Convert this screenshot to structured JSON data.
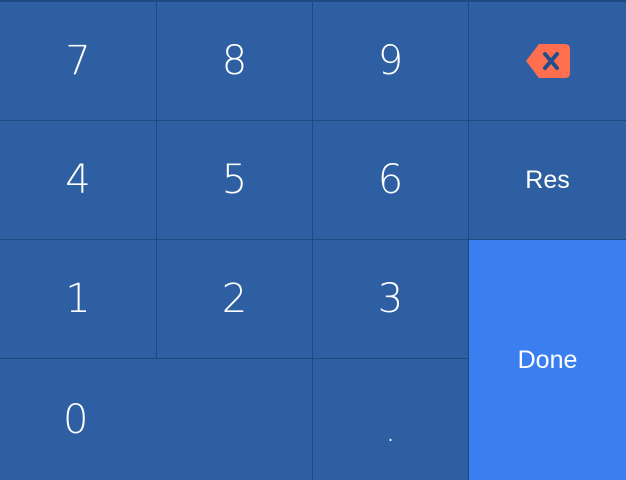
{
  "keypad": {
    "keys": {
      "seven": "7",
      "eight": "8",
      "nine": "9",
      "four": "4",
      "five": "5",
      "six": "6",
      "one": "1",
      "two": "2",
      "three": "3",
      "zero": "0",
      "dot": "."
    },
    "actions": {
      "reset_label": "Res",
      "done_label": "Done",
      "backspace_icon": "backspace-icon"
    }
  },
  "colors": {
    "key_background": "#2d5fa2",
    "grid_line": "#1d4a80",
    "done_background": "#3a7ef0",
    "backspace_accent": "#ff6f4f",
    "text": "#ffffff"
  }
}
